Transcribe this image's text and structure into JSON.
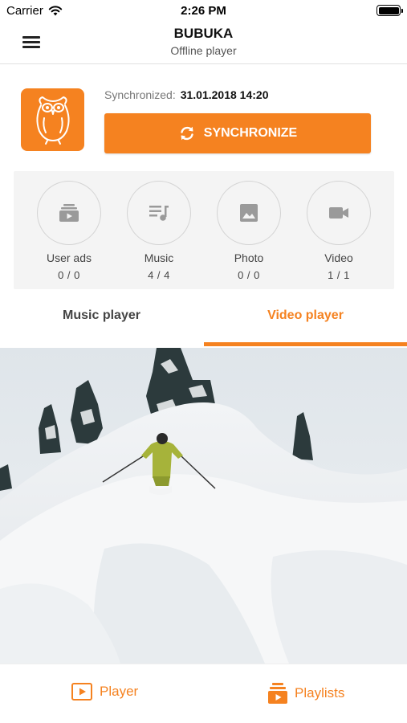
{
  "status_bar": {
    "carrier": "Carrier",
    "time": "2:26 PM"
  },
  "nav": {
    "title": "BUBUKA",
    "subtitle": "Offline player"
  },
  "sync": {
    "label": "Synchronized:",
    "date": "31.01.2018 14:20",
    "button_label": "SYNCHRONIZE"
  },
  "categories": [
    {
      "name": "User ads",
      "count": "0 / 0",
      "icon": "user-ads-icon"
    },
    {
      "name": "Music",
      "count": "4 / 4",
      "icon": "music-list-icon"
    },
    {
      "name": "Photo",
      "count": "0 / 0",
      "icon": "photo-icon"
    },
    {
      "name": "Video",
      "count": "1 / 1",
      "icon": "video-camera-icon"
    }
  ],
  "tabs": [
    {
      "label": "Music player",
      "active": false
    },
    {
      "label": "Video player",
      "active": true
    }
  ],
  "bottom_nav": {
    "player_label": "Player",
    "playlists_label": "Playlists"
  },
  "colors": {
    "accent": "#f58220",
    "panel": "#f4f4f4",
    "icon_gray": "#9a9a9a"
  }
}
